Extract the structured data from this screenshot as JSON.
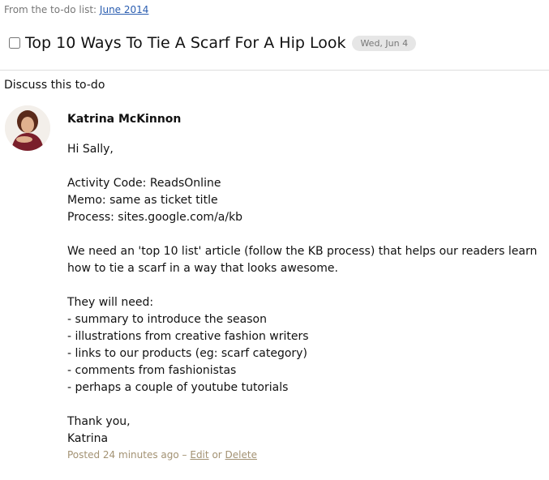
{
  "breadcrumb": {
    "prefix": "From the to-do list:",
    "list_link": "June 2014"
  },
  "todo": {
    "checked": false,
    "title": "Top 10 Ways To Tie A Scarf For A Hip Look",
    "date": "Wed, Jun 4"
  },
  "discussion": {
    "heading": "Discuss this to-do"
  },
  "comment": {
    "author": "Katrina McKinnon",
    "lines": [
      "Hi Sally,",
      "",
      "Activity Code: ReadsOnline",
      "Memo: same as ticket title",
      "Process: sites.google.com/a/kb",
      "",
      "We need an 'top 10 list' article (follow the KB process)  that helps our readers learn",
      "how to tie a scarf in a way that looks awesome.",
      "",
      "They will need:",
      "- summary to introduce the season",
      "- illustrations from creative fashion writers",
      "- links to our products (eg: scarf category)",
      "- comments from fashionistas",
      "- perhaps a couple of youtube tutorials",
      "",
      "Thank you,",
      "Katrina"
    ],
    "meta": {
      "posted": "Posted 24 minutes ago –",
      "edit": "Edit",
      "or": "or",
      "delete": "Delete"
    }
  },
  "colors": {
    "link": "#2a5db0",
    "meta": "#a39273",
    "badge_bg": "#e6e6e6"
  }
}
